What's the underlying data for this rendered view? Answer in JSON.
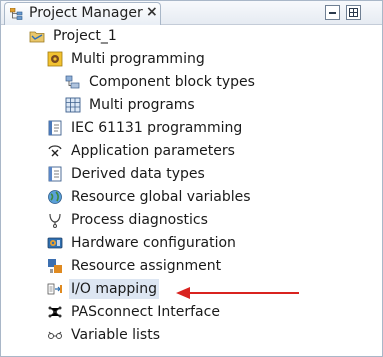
{
  "panel": {
    "tab_title": "Project Manager",
    "close_glyph": "×"
  },
  "tree": {
    "root": {
      "label": "Project_1",
      "icon": "project-folder-icon"
    },
    "multi_programming": {
      "label": "Multi programming",
      "icon": "multi-programming-icon"
    },
    "component_block_types": {
      "label": "Component block types",
      "icon": "block-types-icon"
    },
    "multi_programs": {
      "label": "Multi programs",
      "icon": "grid-icon"
    },
    "items": [
      {
        "label": "IEC 61131 programming",
        "icon": "iec-programming-icon"
      },
      {
        "label": "Application parameters",
        "icon": "parameters-icon"
      },
      {
        "label": "Derived data types",
        "icon": "data-types-icon"
      },
      {
        "label": "Resource global variables",
        "icon": "globe-icon"
      },
      {
        "label": "Process diagnostics",
        "icon": "diagnostics-icon"
      },
      {
        "label": "Hardware configuration",
        "icon": "hardware-icon"
      },
      {
        "label": "Resource assignment",
        "icon": "assignment-icon"
      },
      {
        "label": "I/O mapping",
        "icon": "io-mapping-icon"
      },
      {
        "label": "PASconnect Interface",
        "icon": "network-icon"
      },
      {
        "label": "Variable lists",
        "icon": "variables-icon"
      }
    ]
  },
  "annotation": {
    "arrow_color": "#d9231f",
    "points_to": "I/O mapping"
  }
}
